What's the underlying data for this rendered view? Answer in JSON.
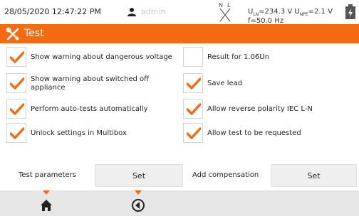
{
  "status": {
    "datetime": "28/05/2020 12:47:22 PM",
    "user": "admin",
    "u_ln_label": "U",
    "u_ln_sub": "LN",
    "u_ln_value": "=234.3 V",
    "u_npe_label": "U",
    "u_npe_sub": "NPE",
    "u_npe_value": "=2.1 V",
    "freq": "f=50.0 Hz",
    "plug_n": "N",
    "plug_l": "L"
  },
  "title": "Test",
  "options": [
    {
      "label": "Show warning about dangerous voltage",
      "checked": true
    },
    {
      "label": "Show warning about switched off appliance",
      "checked": true
    },
    {
      "label": "Perform auto-tests automatically",
      "checked": true
    },
    {
      "label": "Unlock settings in Multibox",
      "checked": true
    },
    {
      "label": "Result for 1.06Un",
      "checked": false
    },
    {
      "label": "Save lead",
      "checked": true
    },
    {
      "label": "Allow reverse polarity IEC L-N",
      "checked": true
    },
    {
      "label": "Allow test to be requested",
      "checked": true
    }
  ],
  "params": {
    "test_parameters_label": "Test parameters",
    "test_parameters_button": "Set",
    "add_compensation_label": "Add compensation",
    "add_compensation_button": "Set"
  },
  "colors": {
    "accent": "#f36a10"
  },
  "icons": {
    "user": "user-icon",
    "plug": "plug-icon",
    "battery": "battery-icon",
    "title": "tools-icon",
    "home": "home-icon",
    "back": "back-icon"
  }
}
